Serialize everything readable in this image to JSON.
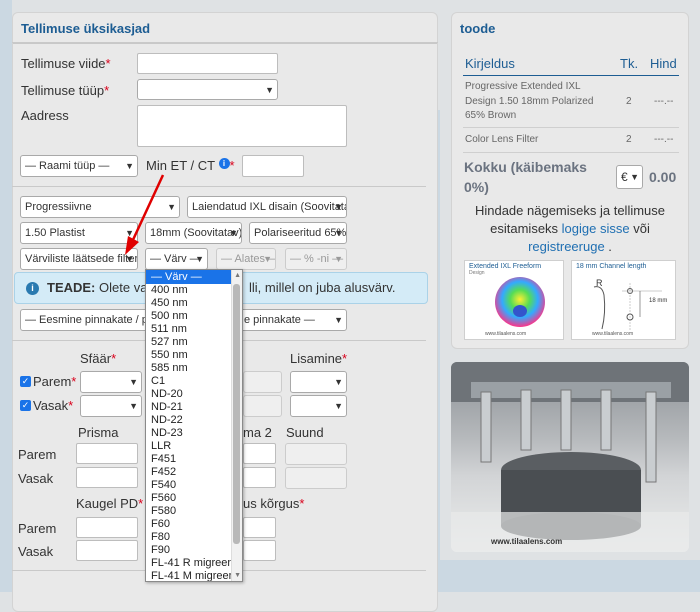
{
  "order": {
    "title": "Tellimuse üksikasjad",
    "fields": {
      "ref_label": "Tellimuse viide",
      "type_label": "Tellimuse tüüp",
      "address_label": "Aadress",
      "frame_type": "— Raami tüüp —",
      "min_et_ct_label": "Min ET / CT",
      "info_icon": "i"
    },
    "lens": {
      "design_type": "Progressiivne",
      "design_detail": "Laiendatud IXL disain (Soovitatav)",
      "index": "1.50 Plastist",
      "channel": "18mm (Soovitatav)",
      "polarized": "Polariseeritud 65%",
      "tint_type": "Värviliste läätsede filter",
      "color": "— Värv —",
      "from": "— Alates —",
      "pct": "— % -ni —"
    },
    "notice": {
      "prefix": "TEADE:",
      "text_left": "Olete val",
      "text_right": "lli, millel on juba alusvärv."
    },
    "coating": {
      "primary": "— Eesmine pinnakate / pe",
      "secondary": "e pinnakate —"
    },
    "rx": {
      "sphere_label": "Sfäär",
      "addition_label": "Lisamine",
      "right_label": "Parem",
      "left_label": "Vasak",
      "prism_label": "Prisma",
      "prism2_label": "ma 2",
      "direction_label": "Suund",
      "pd_label": "Kaugel PD",
      "height_label": "us kõrgus",
      "required": "*"
    },
    "color_dropdown": {
      "options": [
        "— Värv —",
        "400 nm",
        "450 nm",
        "500 nm",
        "511 nm",
        "527 nm",
        "550 nm",
        "585 nm",
        "C1",
        "ND-20",
        "ND-21",
        "ND-22",
        "ND-23",
        "LLR",
        "F451",
        "F452",
        "F540",
        "F560",
        "F580",
        "F60",
        "F80",
        "F90",
        "FL-41 R migreen",
        "FL-41 M migreen"
      ]
    }
  },
  "product": {
    "title": "toode",
    "headers": {
      "desc": "Kirjeldus",
      "qty": "Tk.",
      "price": "Hind"
    },
    "rows": [
      {
        "desc_l1": "Progressive Extended IXL",
        "desc_l2": "Design 1.50 18mm Polarized",
        "desc_l3": "65% Brown",
        "qty": "2",
        "price": "---.--"
      },
      {
        "desc_l1": "Color Lens Filter",
        "qty": "2",
        "price": "---.--"
      }
    ],
    "total_label_l1": "Kokku (käibemaks",
    "total_label_l2": "0%)",
    "currency": "€",
    "total_value": "0.00",
    "login_text_l1": "Hindade nägemiseks ja tellimuse",
    "login_text_l2_pre": "esitamiseks ",
    "login_link": "logige sisse",
    "login_or": " või",
    "register_link": "registreeruge",
    "register_end": " .",
    "promo1_title": "Extended IXL Freeform",
    "promo1_sub": "Design",
    "promo1_footer": "www.tilaalens.com",
    "promo2_title": "18 mm Channel length",
    "promo2_r": "R",
    "promo2_mm": "18 mm",
    "promo2_footer": "www.tilaalens.com",
    "photo_footer": "www.tilaalens.com"
  },
  "colors": {
    "accent": "#1d5d93",
    "required": "#d9001b",
    "selected": "#1a73e8"
  }
}
